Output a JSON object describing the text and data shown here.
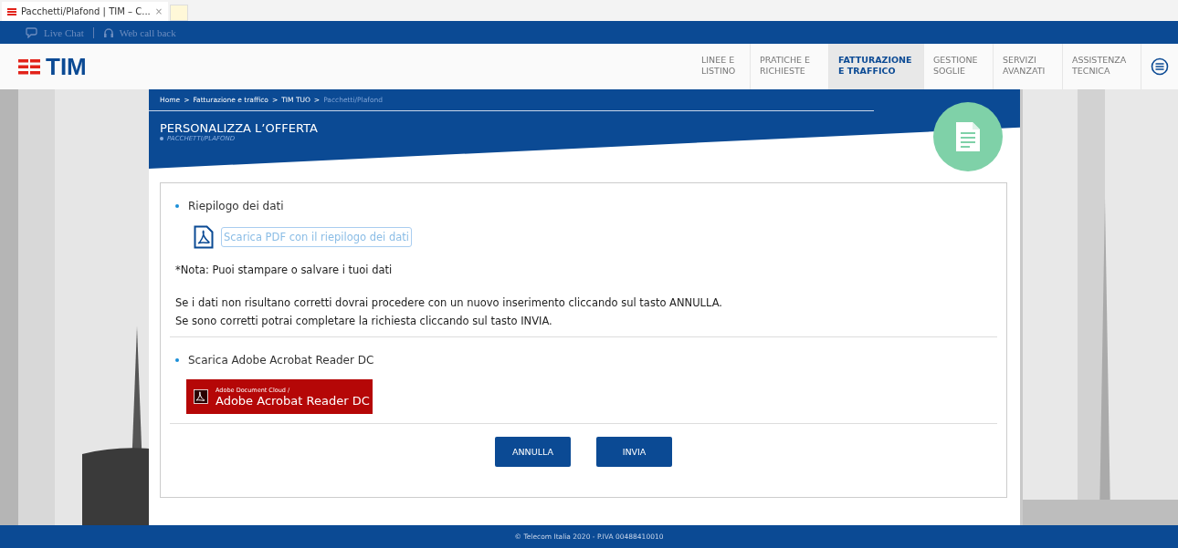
{
  "browser_tab": {
    "title": "Pacchetti/Plafond | TIM – C...",
    "close": "×"
  },
  "top_links": [
    {
      "label": "Live Chat",
      "kind": "chat"
    },
    {
      "label": "Web call back",
      "kind": "headset"
    }
  ],
  "logo": "TIM",
  "nav": [
    {
      "label": "LINEE E LISTINO",
      "selected": false
    },
    {
      "label": "PRATICHE E RICHIESTE",
      "selected": false
    },
    {
      "label": "FATTURAZIONE E TRAFFICO",
      "selected": true
    },
    {
      "label": "GESTIONE SOGLIE",
      "selected": false
    },
    {
      "label": "SERVIZI AVANZATI",
      "selected": false
    },
    {
      "label": "ASSISTENZA TECNICA",
      "selected": false
    }
  ],
  "breadcrumb": [
    {
      "label": "Home",
      "current": false
    },
    {
      "label": "Fatturazione e traffico",
      "current": false
    },
    {
      "label": "TIM TUO",
      "current": false
    },
    {
      "label": "Pacchetti/Plafond",
      "current": true
    }
  ],
  "breadcrumb_separator": ">",
  "page_title": "PERSONALIZZA L’OFFERTA",
  "page_subtitle": "PACCHETTI/PLAFOND",
  "summary": {
    "heading": "Riepilogo dei dati",
    "download_link": "Scarica PDF con il riepilogo dei dati",
    "note": "*Nota: Puoi stampare o salvare i tuoi dati",
    "paragraphs": [
      "Se i dati non risultano corretti dovrai procedere con un nuovo inserimento cliccando sul tasto ANNULLA.",
      "Se sono corretti potrai completare la richiesta cliccando sul tasto INVIA."
    ]
  },
  "reader": {
    "heading": "Scarica Adobe Acrobat Reader DC",
    "badge_small": "Adobe Document Cloud /",
    "badge_main": "Adobe Acrobat Reader DC"
  },
  "buttons": [
    "ANNULLA",
    "INVIA"
  ],
  "footer": "© Telecom Italia 2020 - P.IVA 00488410010"
}
